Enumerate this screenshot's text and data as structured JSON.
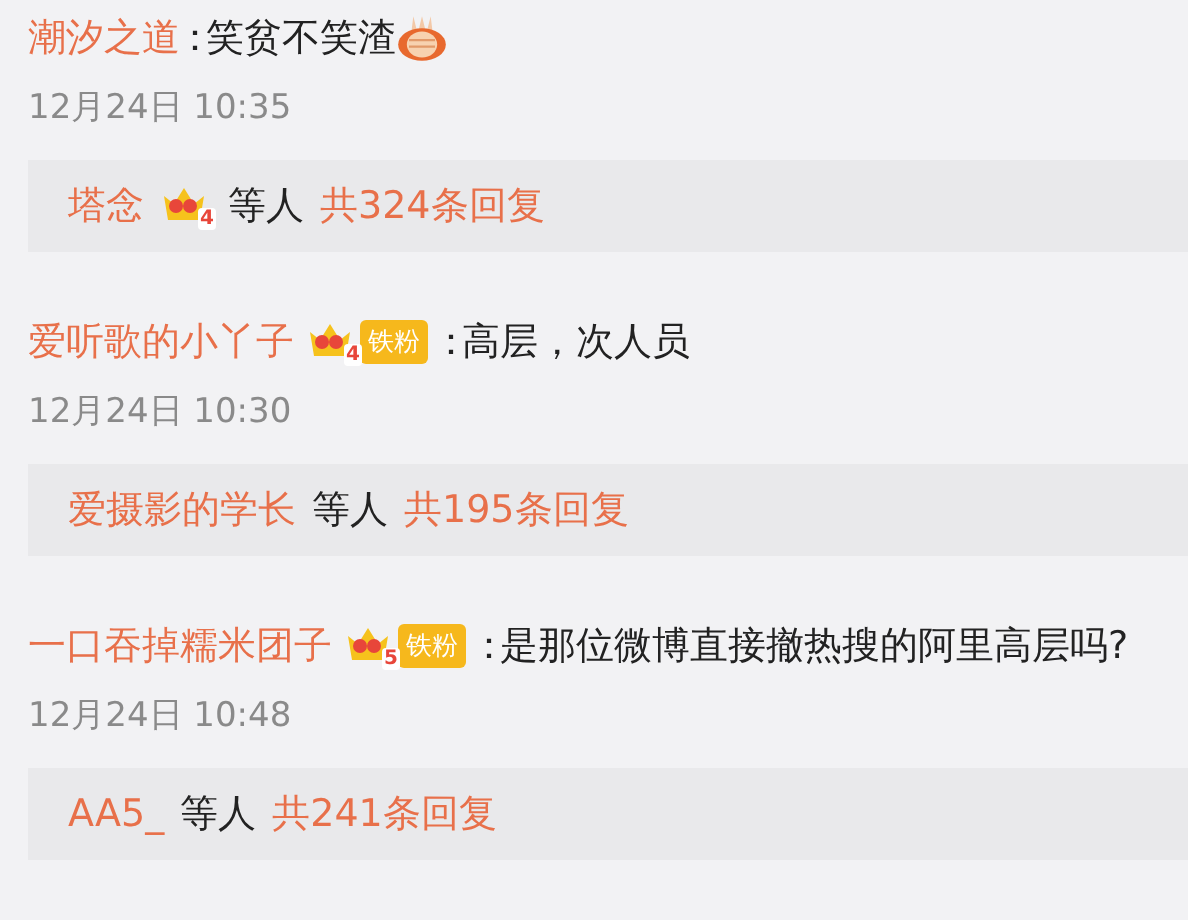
{
  "comments": [
    {
      "author": "潮汐之道",
      "colon": "：",
      "text": "笑贫不笑渣",
      "emoji": true,
      "time": "12月24日 10:35",
      "reply_summary": {
        "replier": "塔念",
        "badge": {
          "level": "4"
        },
        "suffix": "等人",
        "count": "共324条回复"
      }
    },
    {
      "author": "爱听歌的小丫子",
      "badge": {
        "level": "4",
        "tag": "铁粉"
      },
      "colon": "：",
      "text": "高层，次人员",
      "time": "12月24日 10:30",
      "reply_summary": {
        "replier": "爱摄影的学长",
        "suffix": "等人",
        "count": "共195条回复"
      }
    },
    {
      "author": "一口吞掉糯米团子",
      "badge": {
        "level": "5",
        "tag": "铁粉"
      },
      "colon": "：",
      "text": "是那位微博直接撤热搜的阿里高层吗?",
      "time": "12月24日 10:48",
      "reply_summary": {
        "replier": "AA5_",
        "suffix": "等人",
        "count": "共241条回复"
      }
    }
  ]
}
